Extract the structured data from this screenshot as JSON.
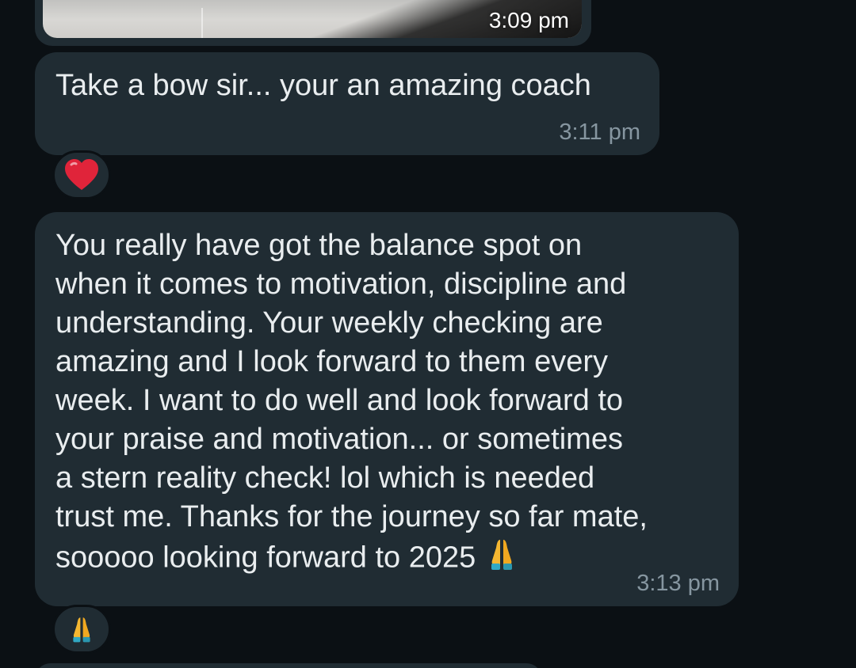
{
  "messages": [
    {
      "type": "image",
      "time": "3:09 pm"
    },
    {
      "type": "text",
      "text": "Take a bow sir... your an amazing coach",
      "time": "3:11 pm",
      "reaction": "heart-icon"
    },
    {
      "type": "text",
      "text": "You really have got the balance spot on\nwhen it comes to motivation, discipline and\nunderstanding. Your weekly checking are\namazing and I look forward to them every\nweek. I want to do well and look forward to\nyour praise and motivation... or sometimes\na stern reality check! lol which is needed\ntrust me. Thanks for the journey so far mate,\nsooooo looking forward to 2025",
      "time": "3:13 pm",
      "emoji": "praying-hands-icon",
      "reaction": "praying-hands-icon"
    }
  ],
  "colors": {
    "background": "#0b1014",
    "bubble": "#202c33",
    "text": "#e9edef",
    "timestamp": "#8696a0",
    "heart": "#e0243a",
    "praying_hands": "#f5b731"
  }
}
